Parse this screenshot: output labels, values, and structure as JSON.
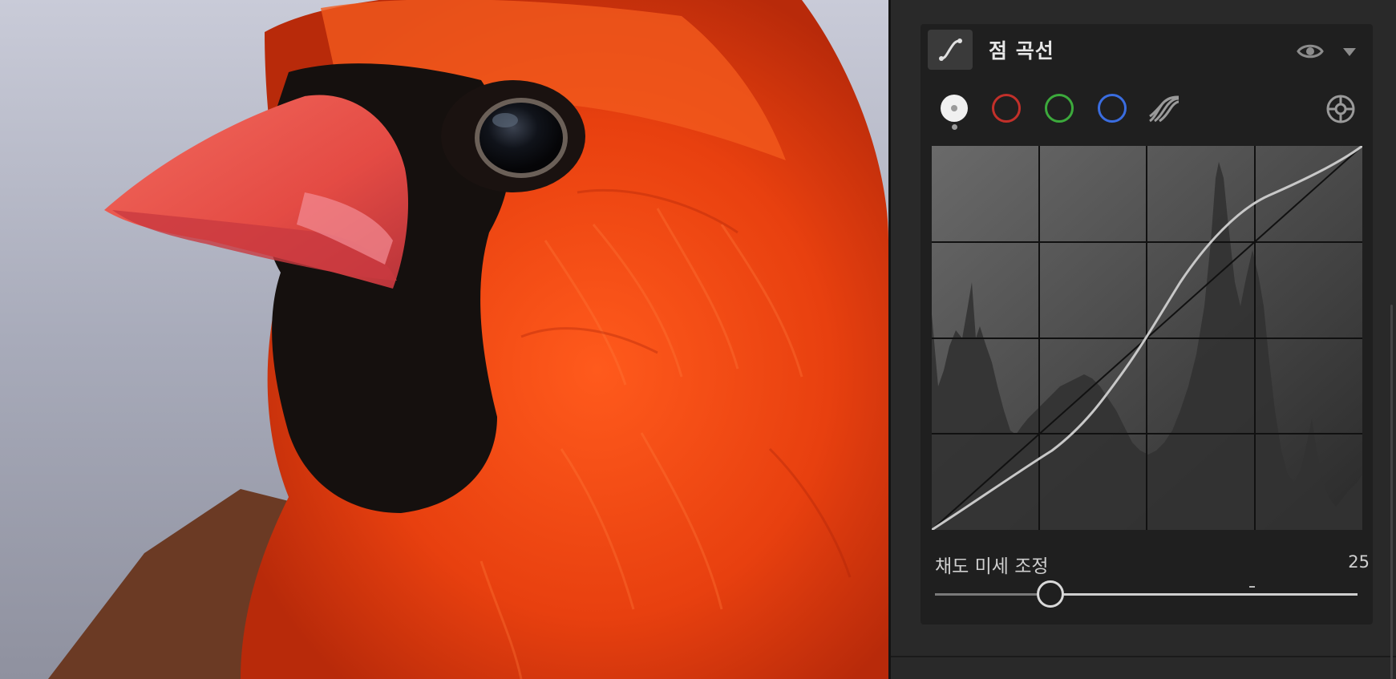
{
  "panel": {
    "title": "점 곡선",
    "header_icon": "curve-icon",
    "visibility_icon": "eye-icon",
    "collapse_icon": "caret-down-icon"
  },
  "channels": [
    {
      "name": "luminance-channel",
      "color": "#f0f0f0",
      "selected": true
    },
    {
      "name": "red-channel",
      "color": "#c2302a"
    },
    {
      "name": "green-channel",
      "color": "#3caa3c"
    },
    {
      "name": "blue-channel",
      "color": "#3a6de0"
    },
    {
      "name": "parametric-channel",
      "color": "#9a9a9a"
    }
  ],
  "targeted_adjustment_icon": "target-icon",
  "saturation": {
    "label": "채도 미세 조정",
    "value": "25",
    "slider_fraction": 0.25
  },
  "colors": {
    "panel_bg": "#1f1f1f",
    "outer_bg": "#292929",
    "curve": "#c8c8c8"
  }
}
